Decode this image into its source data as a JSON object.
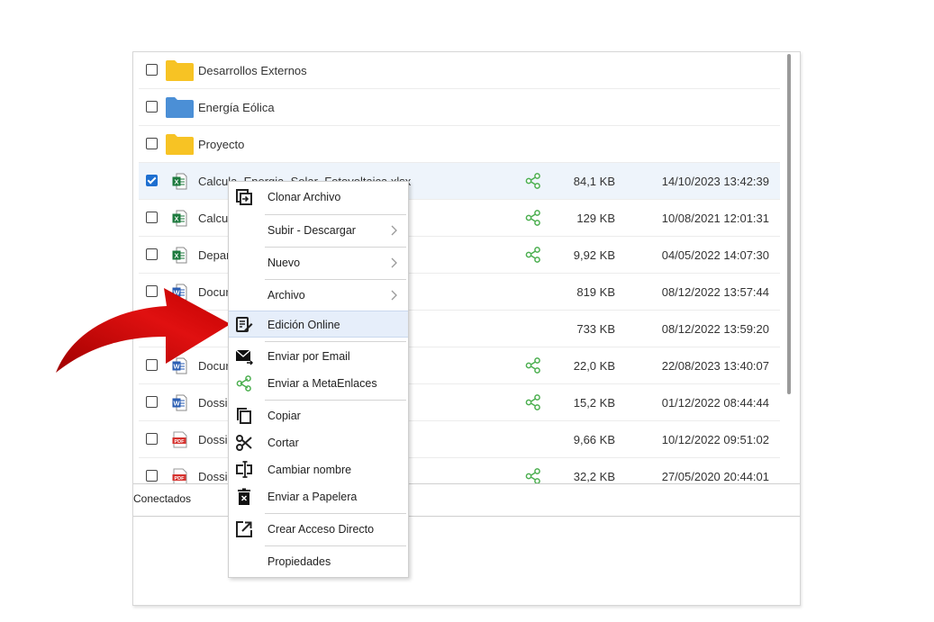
{
  "files": [
    {
      "name": "Desarrollos Externos",
      "type": "folder",
      "color": "#f7c325",
      "checked": false,
      "shared": false,
      "size": "",
      "date": ""
    },
    {
      "name": "Energía Eólica",
      "type": "folder",
      "color": "#4b8fd6",
      "checked": false,
      "shared": false,
      "size": "",
      "date": ""
    },
    {
      "name": "Proyecto",
      "type": "folder",
      "color": "#f7c325",
      "checked": false,
      "shared": false,
      "size": "",
      "date": ""
    },
    {
      "name": "Calcula_Energia_Solar_Fotovoltaica.xlsx",
      "type": "excel",
      "checked": true,
      "shared": true,
      "size": "84,1 KB",
      "date": "14/10/2023 13:42:39"
    },
    {
      "name": "Calcul",
      "type": "excel",
      "checked": false,
      "shared": true,
      "size": "129 KB",
      "date": "10/08/2021 12:01:31"
    },
    {
      "name": "Depar",
      "type": "excel",
      "checked": false,
      "shared": true,
      "size": "9,92 KB",
      "date": "04/05/2022 14:07:30"
    },
    {
      "name": "Docur",
      "type": "word",
      "checked": false,
      "shared": false,
      "size": "819 KB",
      "date": "08/12/2022 13:57:44"
    },
    {
      "name": "",
      "type": "word",
      "checked": false,
      "shared": false,
      "size": "733 KB",
      "date": "08/12/2022 13:59:20"
    },
    {
      "name": "Docur",
      "type": "word",
      "checked": false,
      "shared": true,
      "size": "22,0 KB",
      "date": "22/08/2023 13:40:07"
    },
    {
      "name": "Dossi",
      "type": "word",
      "checked": false,
      "shared": true,
      "size": "15,2 KB",
      "date": "01/12/2022 08:44:44"
    },
    {
      "name": "Dossi",
      "type": "pdf",
      "checked": false,
      "shared": false,
      "size": "9,66 KB",
      "date": "10/12/2022 09:51:02"
    },
    {
      "name": "Dossi",
      "type": "pdf",
      "checked": false,
      "shared": true,
      "size": "32,2 KB",
      "date": "27/05/2020 20:44:01"
    }
  ],
  "status": {
    "label": "Conectados"
  },
  "context_menu": {
    "items": [
      {
        "label": "Clonar Archivo",
        "icon": "clone-icon",
        "submenu": false
      },
      {
        "label": "Subir - Descargar",
        "icon": "",
        "submenu": true
      },
      {
        "label": "Nuevo",
        "icon": "",
        "submenu": true
      },
      {
        "label": "Archivo",
        "icon": "",
        "submenu": true
      },
      {
        "label": "Edición Online",
        "icon": "edit-document-icon",
        "submenu": false,
        "highlighted": true
      },
      {
        "label": "Enviar por Email",
        "icon": "email-icon",
        "submenu": false
      },
      {
        "label": "Enviar a MetaEnlaces",
        "icon": "share-icon",
        "submenu": false
      },
      {
        "label": "Copiar",
        "icon": "copy-icon",
        "submenu": false
      },
      {
        "label": "Cortar",
        "icon": "scissors-icon",
        "submenu": false
      },
      {
        "label": "Cambiar nombre",
        "icon": "rename-icon",
        "submenu": false
      },
      {
        "label": "Enviar a Papelera",
        "icon": "trash-icon",
        "submenu": false
      },
      {
        "label": "Crear Acceso Directo",
        "icon": "shortcut-icon",
        "submenu": false
      },
      {
        "label": "Propiedades",
        "icon": "",
        "submenu": false
      }
    ]
  },
  "colors": {
    "accent": "#1e6fd0",
    "share": "#4caf50",
    "excel": "#1d7a3e",
    "word": "#2b5eb3",
    "pdf": "#d6322e",
    "arrow": "#d40f0f"
  }
}
